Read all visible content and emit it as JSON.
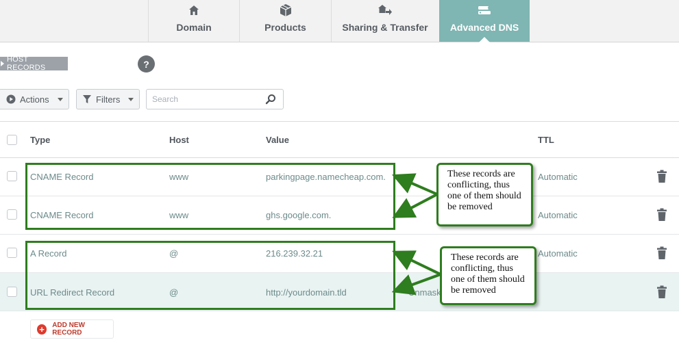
{
  "tabs": [
    {
      "label": "Domain",
      "icon": "home-icon",
      "active": false
    },
    {
      "label": "Products",
      "icon": "box-icon",
      "active": false
    },
    {
      "label": "Sharing & Transfer",
      "icon": "transfer-icon",
      "active": false
    },
    {
      "label": "Advanced DNS",
      "icon": "dns-server-icon",
      "active": true
    }
  ],
  "section": {
    "label": "HOST RECORDS",
    "help": "?"
  },
  "toolbar": {
    "actions_label": "Actions",
    "filters_label": "Filters",
    "search_placeholder": "Search"
  },
  "table": {
    "headers": {
      "type": "Type",
      "host": "Host",
      "value": "Value",
      "ttl": "TTL"
    },
    "rows": [
      {
        "type": "CNAME Record",
        "host": "www",
        "value": "parkingpage.namecheap.com.",
        "ttl": "Automatic",
        "extra": ""
      },
      {
        "type": "CNAME Record",
        "host": "www",
        "value": "ghs.google.com.",
        "ttl": "Automatic",
        "extra": ""
      },
      {
        "type": "A Record",
        "host": "@",
        "value": "216.239.32.21",
        "ttl": "Automatic",
        "extra": ""
      },
      {
        "type": "URL Redirect Record",
        "host": "@",
        "value": "http://yourdomain.tld",
        "ttl": "",
        "extra": "Unmask"
      }
    ]
  },
  "add_record_label": "ADD NEW RECORD",
  "annotations": [
    {
      "text": "These records are conflicting, thus one of them should be removed"
    },
    {
      "text": "These records are conflicting, thus one of them should be removed"
    }
  ],
  "colors": {
    "active_tab": "#7fb5b2",
    "annotation_green": "#2e7d1e",
    "add_red": "#dd3b2e",
    "row_highlight": "#e9f3f2"
  }
}
